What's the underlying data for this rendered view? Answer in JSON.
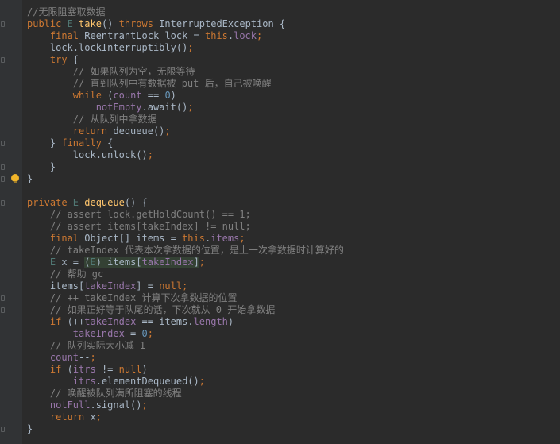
{
  "editor": {
    "lines": [
      [
        {
          "t": "//无限阻塞取数据",
          "c": "cm"
        }
      ],
      [
        {
          "t": "public ",
          "c": "kw"
        },
        {
          "t": "E ",
          "c": "gen"
        },
        {
          "t": "take",
          "c": "fn"
        },
        {
          "t": "() ",
          "c": "ty"
        },
        {
          "t": "throws ",
          "c": "kw"
        },
        {
          "t": "InterruptedException {",
          "c": "ty"
        }
      ],
      [
        {
          "t": "    final ",
          "c": "kw"
        },
        {
          "t": "ReentrantLock lock = ",
          "c": "ty"
        },
        {
          "t": "this",
          "c": "kw"
        },
        {
          "t": ".",
          "c": "ty"
        },
        {
          "t": "lock",
          "c": "field"
        },
        {
          "t": ";",
          "c": "kw"
        }
      ],
      [
        {
          "t": "    lock.lockInterruptibly()",
          "c": "ty"
        },
        {
          "t": ";",
          "c": "kw"
        }
      ],
      [
        {
          "t": "    try ",
          "c": "kw"
        },
        {
          "t": "{",
          "c": "ty"
        }
      ],
      [
        {
          "t": "        // 如果队列为空，无限等待",
          "c": "cm"
        }
      ],
      [
        {
          "t": "        // 直到队列中有数据被 put 后，自己被唤醒",
          "c": "cm"
        }
      ],
      [
        {
          "t": "        while ",
          "c": "kw"
        },
        {
          "t": "(",
          "c": "ty"
        },
        {
          "t": "count ",
          "c": "field"
        },
        {
          "t": "== ",
          "c": "ty"
        },
        {
          "t": "0",
          "c": "num"
        },
        {
          "t": ")",
          "c": "ty"
        }
      ],
      [
        {
          "t": "            ",
          "c": "ty"
        },
        {
          "t": "notEmpty",
          "c": "field"
        },
        {
          "t": ".await()",
          "c": "ty"
        },
        {
          "t": ";",
          "c": "kw"
        }
      ],
      [
        {
          "t": "        // 从队列中拿数据",
          "c": "cm"
        }
      ],
      [
        {
          "t": "        return ",
          "c": "kw"
        },
        {
          "t": "dequeue()",
          "c": "ty"
        },
        {
          "t": ";",
          "c": "kw"
        }
      ],
      [
        {
          "t": "    } ",
          "c": "ty"
        },
        {
          "t": "finally ",
          "c": "kw"
        },
        {
          "t": "{",
          "c": "ty"
        }
      ],
      [
        {
          "t": "        lock.unlock()",
          "c": "ty"
        },
        {
          "t": ";",
          "c": "kw"
        }
      ],
      [
        {
          "t": "    }",
          "c": "ty"
        }
      ],
      [
        {
          "t": "}",
          "c": "ty"
        }
      ],
      [],
      [
        {
          "t": "private ",
          "c": "kw"
        },
        {
          "t": "E ",
          "c": "gen"
        },
        {
          "t": "dequeue",
          "c": "fn"
        },
        {
          "t": "() {",
          "c": "ty"
        }
      ],
      [
        {
          "t": "    // assert lock.getHoldCount() == 1;",
          "c": "cm"
        }
      ],
      [
        {
          "t": "    // assert items[takeIndex] != null;",
          "c": "cm"
        }
      ],
      [
        {
          "t": "    final ",
          "c": "kw"
        },
        {
          "t": "Object[] items = ",
          "c": "ty"
        },
        {
          "t": "this",
          "c": "kw"
        },
        {
          "t": ".",
          "c": "ty"
        },
        {
          "t": "items",
          "c": "field"
        },
        {
          "t": ";",
          "c": "kw"
        }
      ],
      [
        {
          "t": "    // takeIndex 代表本次拿数据的位置，是上一次拿数据时计算好的",
          "c": "cm"
        }
      ],
      [
        {
          "t": "    ",
          "c": "ty"
        },
        {
          "t": "E ",
          "c": "gen"
        },
        {
          "t": "x = ",
          "c": "ty"
        },
        {
          "t": "(",
          "c": "ty hl"
        },
        {
          "t": "E",
          "c": "gen hl"
        },
        {
          "t": ") items[",
          "c": "ty hl"
        },
        {
          "t": "takeIndex",
          "c": "field hl"
        },
        {
          "t": "]",
          "c": "ty hl"
        },
        {
          "t": ";",
          "c": "kw"
        }
      ],
      [
        {
          "t": "    // 帮助 gc",
          "c": "cm"
        }
      ],
      [
        {
          "t": "    items[",
          "c": "ty"
        },
        {
          "t": "takeIndex",
          "c": "field"
        },
        {
          "t": "] = ",
          "c": "ty"
        },
        {
          "t": "null",
          "c": "kw"
        },
        {
          "t": ";",
          "c": "kw"
        }
      ],
      [
        {
          "t": "    // ++ takeIndex 计算下次拿数据的位置",
          "c": "cm"
        }
      ],
      [
        {
          "t": "    // 如果正好等于队尾的话，下次就从 0 开始拿数据",
          "c": "cm"
        }
      ],
      [
        {
          "t": "    if ",
          "c": "kw"
        },
        {
          "t": "(++",
          "c": "ty"
        },
        {
          "t": "takeIndex ",
          "c": "field"
        },
        {
          "t": "== items.",
          "c": "ty"
        },
        {
          "t": "length",
          "c": "field"
        },
        {
          "t": ")",
          "c": "ty"
        }
      ],
      [
        {
          "t": "        ",
          "c": "ty"
        },
        {
          "t": "takeIndex ",
          "c": "field"
        },
        {
          "t": "= ",
          "c": "ty"
        },
        {
          "t": "0",
          "c": "num"
        },
        {
          "t": ";",
          "c": "kw"
        }
      ],
      [
        {
          "t": "    // 队列实际大小减 1",
          "c": "cm"
        }
      ],
      [
        {
          "t": "    ",
          "c": "ty"
        },
        {
          "t": "count",
          "c": "field"
        },
        {
          "t": "--",
          "c": "ty"
        },
        {
          "t": ";",
          "c": "kw"
        }
      ],
      [
        {
          "t": "    if ",
          "c": "kw"
        },
        {
          "t": "(",
          "c": "ty"
        },
        {
          "t": "itrs ",
          "c": "field"
        },
        {
          "t": "!= ",
          "c": "ty"
        },
        {
          "t": "null",
          "c": "kw"
        },
        {
          "t": ")",
          "c": "ty"
        }
      ],
      [
        {
          "t": "        ",
          "c": "ty"
        },
        {
          "t": "itrs",
          "c": "field"
        },
        {
          "t": ".elementDequeued()",
          "c": "ty"
        },
        {
          "t": ";",
          "c": "kw"
        }
      ],
      [
        {
          "t": "    // 唤醒被队列满所阻塞的线程",
          "c": "cm"
        }
      ],
      [
        {
          "t": "    ",
          "c": "ty"
        },
        {
          "t": "notFull",
          "c": "field"
        },
        {
          "t": ".signal()",
          "c": "ty"
        },
        {
          "t": ";",
          "c": "kw"
        }
      ],
      [
        {
          "t": "    return ",
          "c": "kw"
        },
        {
          "t": "x",
          "c": "ty"
        },
        {
          "t": ";",
          "c": "kw"
        }
      ],
      [
        {
          "t": "}",
          "c": "ty"
        }
      ]
    ],
    "fold_markers": [
      1,
      4,
      11,
      13,
      14,
      16,
      24,
      25,
      35
    ],
    "intention_bulb_line": 14,
    "icons": {
      "fold": "fold-marker-icon",
      "bulb": "lightbulb-icon"
    }
  }
}
